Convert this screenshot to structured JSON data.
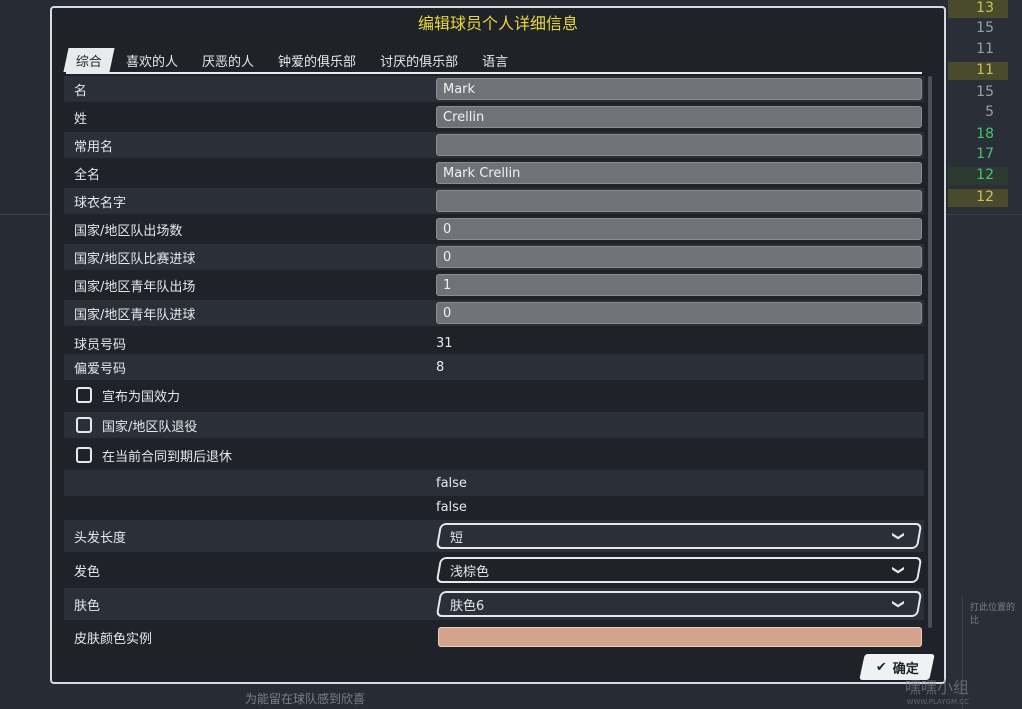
{
  "dialog": {
    "title": "编辑球员个人详细信息",
    "ok_label": "确定"
  },
  "tabs": [
    "综合",
    "喜欢的人",
    "厌恶的人",
    "钟爱的俱乐部",
    "讨厌的俱乐部",
    "语言"
  ],
  "fields": {
    "first_name": {
      "label": "名",
      "value": "Mark"
    },
    "last_name": {
      "label": "姓",
      "value": "Crellin"
    },
    "common_name": {
      "label": "常用名",
      "value": ""
    },
    "full_name": {
      "label": "全名",
      "value": "Mark Crellin"
    },
    "shirt_name": {
      "label": "球衣名字",
      "value": ""
    },
    "intl_caps": {
      "label": "国家/地区队出场数",
      "value": "0"
    },
    "intl_goals": {
      "label": "国家/地区队比赛进球",
      "value": "0"
    },
    "youth_caps": {
      "label": "国家/地区青年队出场",
      "value": "1"
    },
    "youth_goals": {
      "label": "国家/地区青年队进球",
      "value": "0"
    },
    "squad_number": {
      "label": "球员号码",
      "value": "31"
    },
    "preferred_number": {
      "label": "偏爱号码",
      "value": "8"
    }
  },
  "checkboxes": {
    "declared_for_nation": "宣布为国效力",
    "retired_international": "国家/地区队退役",
    "retire_at_contract_end": "在当前合同到期后退休"
  },
  "flags": [
    "false",
    "false"
  ],
  "selects": {
    "hair_length": {
      "label": "头发长度",
      "value": "短"
    },
    "hair_color": {
      "label": "发色",
      "value": "浅棕色"
    },
    "skin_tone": {
      "label": "肤色",
      "value": "肤色6"
    }
  },
  "skin_sample": {
    "label": "皮肤颜色实例",
    "color": "#d4a38c"
  },
  "background": {
    "right_numbers": [
      "13",
      "15",
      "11",
      "11",
      "15",
      "5",
      "18",
      "17",
      "12",
      "12"
    ],
    "bottom_text": "为能留在球队感到欣喜",
    "side_text": "打此位置的比"
  },
  "watermark": {
    "text": "嘿嘿小组",
    "sub": "WWW.PLAYGM.CC"
  }
}
